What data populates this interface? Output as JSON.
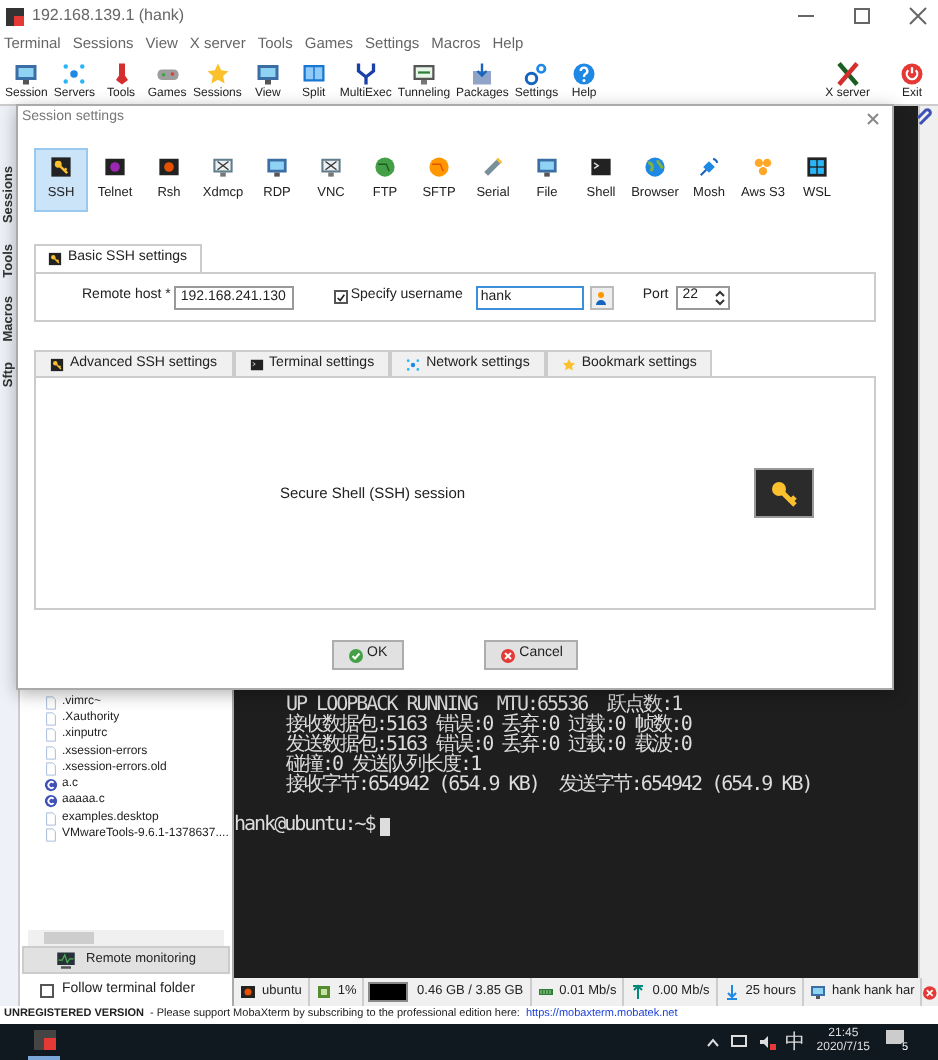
{
  "window": {
    "title": "192.168.139.1 (hank)"
  },
  "menu": [
    "Terminal",
    "Sessions",
    "View",
    "X server",
    "Tools",
    "Games",
    "Settings",
    "Macros",
    "Help"
  ],
  "toolbar": [
    "Session",
    "Servers",
    "Tools",
    "Games",
    "Sessions",
    "View",
    "Split",
    "MultiExec",
    "Tunneling",
    "Packages",
    "Settings",
    "Help"
  ],
  "toolbar_right": [
    "X server",
    "Exit"
  ],
  "side_tabs": [
    "Sessions",
    "Tools",
    "Macros",
    "Sftp"
  ],
  "files": [
    ".vimrc~",
    ".Xauthority",
    ".xinputrc",
    ".xsession-errors",
    ".xsession-errors.old",
    "a.c",
    "aaaaa.c",
    "examples.desktop",
    "VMwareTools-9.6.1-1378637...."
  ],
  "remote_monitoring": "Remote monitoring",
  "follow_folder": {
    "label": "Follow terminal folder",
    "checked": false
  },
  "terminal": {
    "lines": [
      "UP LOOPBACK RUNNING  MTU:65536  跃点数:1",
      "接收数据包:5163 错误:0 丢弃:0 过载:0 帧数:0",
      "发送数据包:5163 错误:0 丢弃:0 过载:0 载波:0",
      "碰撞:0 发送队列长度:1",
      "接收字节:654942 (654.9 KB)  发送字节:654942 (654.9 KB)"
    ],
    "prompt": "hank@ubuntu:~$"
  },
  "status_bar": [
    "ubuntu",
    "1%",
    "0.46 GB / 3.85 GB",
    "0.01 Mb/s",
    "0.00 Mb/s",
    "25 hours",
    "hank  hank  har"
  ],
  "notice": {
    "label": "UNREGISTERED VERSION",
    "text": "-  Please support MobaXterm by subscribing to the professional edition here:",
    "link": "https://mobaxterm.mobatek.net"
  },
  "taskbar": {
    "ime": "中",
    "time": "21:45",
    "date": "2020/7/15",
    "notifications": "5"
  },
  "dialog": {
    "title": "Session settings",
    "protocols": [
      {
        "label": "SSH",
        "selected": true
      },
      {
        "label": "Telnet",
        "selected": false
      },
      {
        "label": "Rsh",
        "selected": false
      },
      {
        "label": "Xdmcp",
        "selected": false
      },
      {
        "label": "RDP",
        "selected": false
      },
      {
        "label": "VNC",
        "selected": false
      },
      {
        "label": "FTP",
        "selected": false
      },
      {
        "label": "SFTP",
        "selected": false
      },
      {
        "label": "Serial",
        "selected": false
      },
      {
        "label": "File",
        "selected": false
      },
      {
        "label": "Shell",
        "selected": false
      },
      {
        "label": "Browser",
        "selected": false
      },
      {
        "label": "Mosh",
        "selected": false
      },
      {
        "label": "Aws S3",
        "selected": false
      },
      {
        "label": "WSL",
        "selected": false
      }
    ],
    "basic_tab": "Basic SSH settings",
    "remote_host": {
      "label": "Remote host *",
      "value": "192.168.241.130"
    },
    "specify_username": {
      "label": "Specify username",
      "checked": true
    },
    "username": "hank",
    "port": {
      "label": "Port",
      "value": "22"
    },
    "tabs": [
      "Advanced SSH settings",
      "Terminal settings",
      "Network settings",
      "Bookmark settings"
    ],
    "description": "Secure Shell (SSH) session",
    "buttons": [
      "OK",
      "Cancel"
    ]
  }
}
